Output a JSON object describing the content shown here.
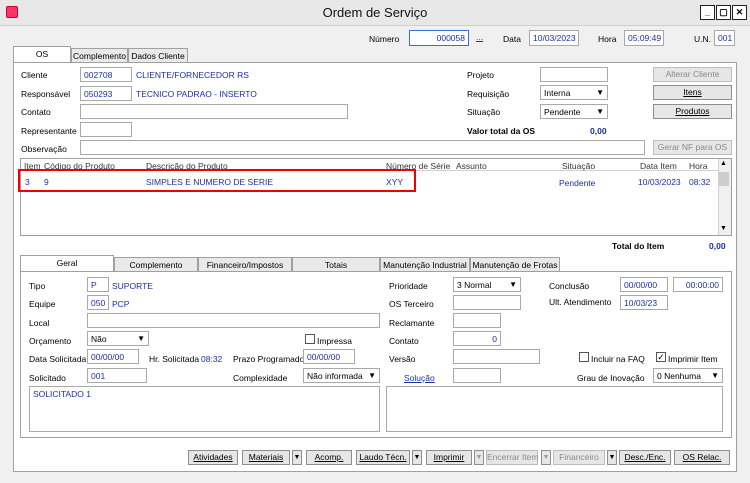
{
  "window": {
    "title": "Ordem de Serviço",
    "min": "_",
    "max": "▢",
    "close": "✕"
  },
  "header": {
    "numero_label": "Número",
    "numero": "000058",
    "numero_btn": "...",
    "data_label": "Data",
    "data": "10/03/2023",
    "hora_label": "Hora",
    "hora": "05:09:49",
    "un_label": "U.N.",
    "un": "001"
  },
  "tabs": [
    "OS",
    "Complemento",
    "Dados Cliente"
  ],
  "os": {
    "cliente_label": "Cliente",
    "cliente_code": "002708",
    "cliente_name": "CLIENTE/FORNECEDOR RS",
    "responsavel_label": "Responsável",
    "responsavel_code": "050293",
    "responsavel_name": "TECNICO PADRAO - INSERTO",
    "contato_label": "Contato",
    "representante_label": "Representante",
    "observacao_label": "Observação",
    "projeto_label": "Projeto",
    "requisicao_label": "Requisição",
    "requisicao": "Interna",
    "situacao_label": "Situação",
    "situacao": "Pendente",
    "valor_total_label": "Valor total da OS",
    "valor_total": "0,00",
    "alterar_cliente": "Alterar Cliente",
    "itens": "Itens",
    "produtos": "Produtos",
    "gerar_nf": "Gerar NF para OS"
  },
  "grid": {
    "headers": [
      "Item",
      "Código do Produto",
      "Descrição do Produto",
      "Número de Série",
      "Assunto",
      "Situação",
      "Data Item",
      "Hora"
    ],
    "rows": [
      {
        "item": "3",
        "codigo": "9",
        "descricao": "SIMPLES E NUMERO DE SERIE",
        "serie": "XYY",
        "assunto": "",
        "situacao": "Pendente",
        "data": "10/03/2023",
        "hora": "08:32"
      }
    ],
    "total_item_label": "Total do Item",
    "total_item": "0,00"
  },
  "subtabs": [
    "Geral",
    "Complemento",
    "Financeiro/Impostos",
    "Totais",
    "Manutenção Industrial",
    "Manutenção de Frotas"
  ],
  "geral": {
    "tipo_label": "Tipo",
    "tipo_code": "P",
    "tipo_name": "SUPORTE",
    "equipe_label": "Equipe",
    "equipe_code": "050",
    "equipe_name": "PCP",
    "local_label": "Local",
    "orcamento_label": "Orçamento",
    "orcamento": "Não",
    "impressa_label": "Impressa",
    "data_solicitada_label": "Data Solicitada",
    "data_solicitada": "00/00/00",
    "hr_solicitada_label": "Hr. Solicitada",
    "hr_solicitada": "08:32",
    "prazo_label": "Prazo Programado",
    "prazo": "00/00/00",
    "solicitado_label": "Solicitado",
    "solicitado": "001",
    "complexidade_label": "Complexidade",
    "complexidade": "Não informada",
    "prioridade_label": "Prioridade",
    "prioridade": "3 Normal",
    "os_terceiro_label": "OS Terceiro",
    "reclamante_label": "Reclamante",
    "contato_label": "Contato",
    "contato": "0",
    "versao_label": "Versão",
    "solucao_label": "Solução",
    "conclusao_label": "Conclusão",
    "conclusao_data": "00/00/00",
    "conclusao_hora": "00:00:00",
    "ult_atendimento_label": "Ult. Atendimento",
    "ult_atendimento": "10/03/23",
    "incluir_faq_label": "Incluir na FAQ",
    "imprimir_item_label": "Imprimir Item",
    "grau_inovacao_label": "Grau de Inovação",
    "grau_inovacao": "0 Nenhuma",
    "memo_solicitado": "SOLICITADO 1"
  },
  "footer": {
    "atividades": "Atividades",
    "materiais": "Materiais",
    "acomp": "Acomp.",
    "laudo": "Laudo Técn.",
    "imprimir": "Imprimir",
    "encerrar": "Encerrar Item",
    "financeiro": "Financeiro",
    "desc_enc": "Desc./Enc.",
    "os_relac": "OS Relac."
  }
}
